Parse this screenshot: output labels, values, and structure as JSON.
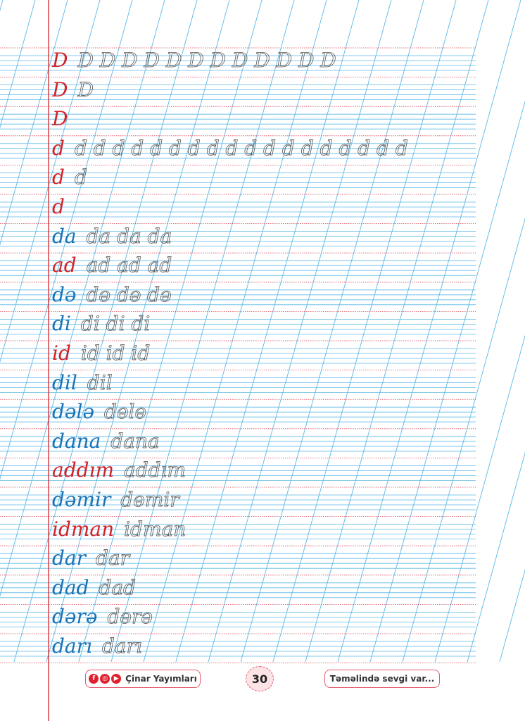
{
  "rows": [
    {
      "model": "D",
      "model_color": "red",
      "trace": "D D D D D D D D D D D D"
    },
    {
      "model": "D",
      "model_color": "red",
      "trace": "D"
    },
    {
      "model": "D",
      "model_color": "red",
      "trace": ""
    },
    {
      "model": "d",
      "model_color": "red",
      "trace": "d d d d d d d d d d d d d d d d d d"
    },
    {
      "model": "d",
      "model_color": "red",
      "trace": "d"
    },
    {
      "model": "d",
      "model_color": "red",
      "trace": ""
    },
    {
      "model": "da",
      "model_color": "blue-red",
      "trace": "da da da"
    },
    {
      "model": "ad",
      "model_color": "red-blue",
      "trace": "ad ad ad"
    },
    {
      "model": "də",
      "model_color": "blue",
      "trace": "də də də"
    },
    {
      "model": "di",
      "model_color": "blue",
      "trace": "di di di"
    },
    {
      "model": "id",
      "model_color": "red",
      "trace": "id id id"
    },
    {
      "model": "dil",
      "model_color": "blue",
      "trace": "dil"
    },
    {
      "model": "dələ",
      "model_color": "blue",
      "trace": "dələ"
    },
    {
      "model": "dana",
      "model_color": "blue-red",
      "trace": "dana"
    },
    {
      "model": "addım",
      "model_color": "red-blue",
      "trace": "addım"
    },
    {
      "model": "dəmir",
      "model_color": "blue-red",
      "trace": "dəmir"
    },
    {
      "model": "idman",
      "model_color": "red-blue",
      "trace": "idman"
    },
    {
      "model": "dar",
      "model_color": "blue-red",
      "trace": "dar"
    },
    {
      "model": "dad",
      "model_color": "blue-red",
      "trace": "dad"
    },
    {
      "model": "dərə",
      "model_color": "blue",
      "trace": "dərə"
    },
    {
      "model": "darı",
      "model_color": "blue-red",
      "trace": "darı"
    }
  ],
  "footer": {
    "publisher": "Çinar Yayımları",
    "social_icons": [
      "facebook-icon",
      "instagram-icon",
      "youtube-icon"
    ],
    "page_number": "30",
    "slogan": "Təməlində sevgi var..."
  },
  "colors": {
    "ruled_line": "#5bb8e6",
    "dotted_line": "#d94a5a",
    "margin_line": "#d2232a",
    "model_red": "#d2232a",
    "model_blue": "#1a73b5"
  }
}
